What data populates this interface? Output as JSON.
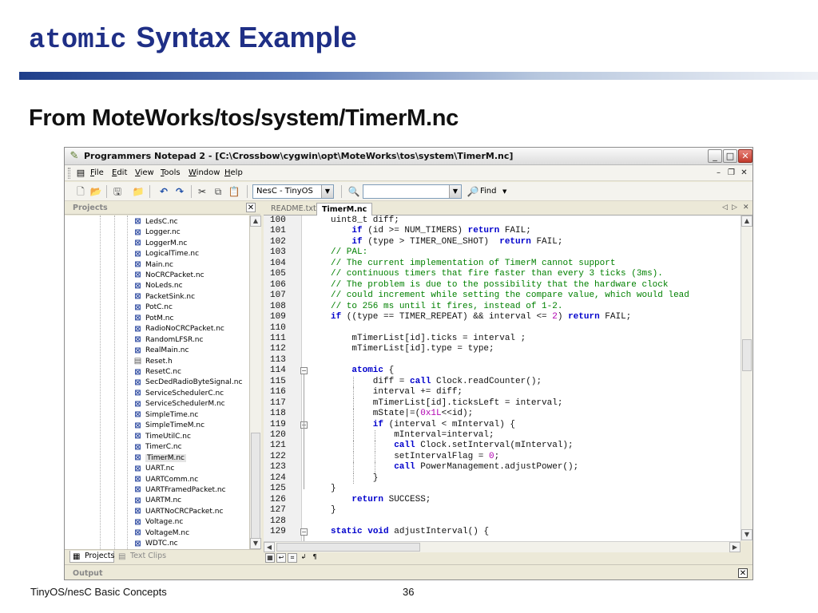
{
  "slide": {
    "title_mono": "atomic",
    "title_text": "Syntax Example",
    "subtitle": "From MoteWorks/tos/system/TimerM.nc",
    "footer_left": "TinyOS/nesC Basic Concepts",
    "page_number": "36"
  },
  "window": {
    "title": "Programmers Notepad 2 - [C:\\Crossbow\\cygwin\\opt\\MoteWorks\\tos\\system\\TimerM.nc]",
    "controls": [
      "_",
      "□",
      "✕"
    ]
  },
  "menu": [
    {
      "u": "F",
      "rest": "ile"
    },
    {
      "u": "E",
      "rest": "dit"
    },
    {
      "u": "V",
      "rest": "iew"
    },
    {
      "u": "T",
      "rest": "ools"
    },
    {
      "u": "W",
      "rest": "indow"
    },
    {
      "u": "H",
      "rest": "elp"
    }
  ],
  "toolbar": {
    "scheme_select": "NesC - TinyOS",
    "search_value": "",
    "find_label": "Find"
  },
  "projects_panel": {
    "header": "Projects",
    "tabs": [
      "Projects",
      "Text Clips"
    ],
    "items": [
      "LedsC.nc",
      "Logger.nc",
      "LoggerM.nc",
      "LogicalTime.nc",
      "Main.nc",
      "NoCRCPacket.nc",
      "NoLeds.nc",
      "PacketSink.nc",
      "PotC.nc",
      "PotM.nc",
      "RadioNoCRCPacket.nc",
      "RandomLFSR.nc",
      "RealMain.nc",
      "Reset.h",
      "ResetC.nc",
      "SecDedRadioByteSignal.nc",
      "ServiceSchedulerC.nc",
      "ServiceSchedulerM.nc",
      "SimpleTime.nc",
      "SimpleTimeM.nc",
      "TimeUtilC.nc",
      "TimerC.nc",
      "TimerM.nc",
      "UART.nc",
      "UARTComm.nc",
      "UARTFramedPacket.nc",
      "UARTM.nc",
      "UARTNoCRCPacket.nc",
      "Voltage.nc",
      "VoltageM.nc",
      "WDTC.nc"
    ],
    "selected": "TimerM.nc"
  },
  "editor": {
    "tabs": [
      "README.txt",
      "TimerM.nc"
    ],
    "active_tab": "TimerM.nc",
    "lines": [
      {
        "n": "100",
        "indent": 0,
        "seg": [
          [
            "",
            "uint8_t diff;"
          ]
        ]
      },
      {
        "n": "101",
        "indent": 1,
        "seg": [
          [
            "kw",
            "if"
          ],
          [
            "",
            " (id >= NUM_TIMERS) "
          ],
          [
            "kw",
            "return"
          ],
          [
            "",
            " FAIL;"
          ]
        ]
      },
      {
        "n": "102",
        "indent": 1,
        "seg": [
          [
            "kw",
            "if"
          ],
          [
            "",
            " (type > TIMER_ONE_SHOT)  "
          ],
          [
            "kw",
            "return"
          ],
          [
            "",
            " FAIL;"
          ]
        ]
      },
      {
        "n": "103",
        "indent": 0,
        "seg": [
          [
            "cm",
            "// PAL:"
          ]
        ]
      },
      {
        "n": "104",
        "indent": 0,
        "seg": [
          [
            "cm",
            "// The current implementation of TimerM cannot support"
          ]
        ]
      },
      {
        "n": "105",
        "indent": 0,
        "seg": [
          [
            "cm",
            "// continuous timers that fire faster than every 3 ticks (3ms)."
          ]
        ]
      },
      {
        "n": "106",
        "indent": 0,
        "seg": [
          [
            "cm",
            "// The problem is due to the possibility that the hardware clock"
          ]
        ]
      },
      {
        "n": "107",
        "indent": 0,
        "seg": [
          [
            "cm",
            "// could increment while setting the compare value, which would lead"
          ]
        ]
      },
      {
        "n": "108",
        "indent": 0,
        "seg": [
          [
            "cm",
            "// to 256 ms until it fires, instead of 1-2."
          ]
        ]
      },
      {
        "n": "109",
        "indent": 0,
        "seg": [
          [
            "kw",
            "if"
          ],
          [
            "",
            " ((type == TIMER_REPEAT) && interval <= "
          ],
          [
            "nm",
            "2"
          ],
          [
            "",
            ") "
          ],
          [
            "kw",
            "return"
          ],
          [
            "",
            " FAIL;"
          ]
        ]
      },
      {
        "n": "110",
        "indent": 0,
        "seg": [
          [
            "",
            ""
          ]
        ]
      },
      {
        "n": "111",
        "indent": 1,
        "seg": [
          [
            "",
            "mTimerList[id].ticks = interval ;"
          ]
        ]
      },
      {
        "n": "112",
        "indent": 1,
        "seg": [
          [
            "",
            "mTimerList[id].type = type;"
          ]
        ]
      },
      {
        "n": "113",
        "indent": 0,
        "seg": [
          [
            "",
            ""
          ]
        ]
      },
      {
        "n": "114",
        "indent": 1,
        "fold": "-",
        "seg": [
          [
            "kw",
            "atomic"
          ],
          [
            "",
            " {"
          ]
        ]
      },
      {
        "n": "115",
        "indent": 2,
        "seg": [
          [
            "",
            "diff = "
          ],
          [
            "kw",
            "call"
          ],
          [
            "",
            " Clock.readCounter();"
          ]
        ]
      },
      {
        "n": "116",
        "indent": 2,
        "seg": [
          [
            "",
            "interval += diff;"
          ]
        ]
      },
      {
        "n": "117",
        "indent": 2,
        "seg": [
          [
            "",
            "mTimerList[id].ticksLeft = interval;"
          ]
        ]
      },
      {
        "n": "118",
        "indent": 2,
        "seg": [
          [
            "",
            "mState|=("
          ],
          [
            "nm",
            "0x1L"
          ],
          [
            "",
            "<<id);"
          ]
        ]
      },
      {
        "n": "119",
        "indent": 2,
        "fold": "-",
        "seg": [
          [
            "kw",
            "if"
          ],
          [
            "",
            " (interval < mInterval) {"
          ]
        ]
      },
      {
        "n": "120",
        "indent": 3,
        "seg": [
          [
            "",
            "mInterval=interval;"
          ]
        ]
      },
      {
        "n": "121",
        "indent": 3,
        "seg": [
          [
            "kw",
            "call"
          ],
          [
            "",
            " Clock.setInterval(mInterval);"
          ]
        ]
      },
      {
        "n": "122",
        "indent": 3,
        "seg": [
          [
            "",
            "setIntervalFlag = "
          ],
          [
            "nm",
            "0"
          ],
          [
            "",
            ";"
          ]
        ]
      },
      {
        "n": "123",
        "indent": 3,
        "seg": [
          [
            "kw",
            "call"
          ],
          [
            "",
            " PowerManagement.adjustPower();"
          ]
        ]
      },
      {
        "n": "124",
        "indent": 2,
        "seg": [
          [
            "",
            "}"
          ]
        ]
      },
      {
        "n": "125",
        "indent": 0,
        "seg": [
          [
            "",
            "}"
          ]
        ]
      },
      {
        "n": "126",
        "indent": 1,
        "seg": [
          [
            "kw",
            "return"
          ],
          [
            "",
            " SUCCESS;"
          ]
        ]
      },
      {
        "n": "127",
        "indent": 0,
        "seg": [
          [
            "",
            "}"
          ]
        ]
      },
      {
        "n": "128",
        "indent": 0,
        "seg": [
          [
            "",
            ""
          ]
        ]
      },
      {
        "n": "129",
        "indent": 0,
        "fold": "-",
        "seg": [
          [
            "kw",
            "static"
          ],
          [
            "",
            " "
          ],
          [
            "kw",
            "void"
          ],
          [
            "",
            " adjustInterval() {"
          ]
        ]
      }
    ]
  },
  "output_panel": {
    "header": "Output"
  }
}
